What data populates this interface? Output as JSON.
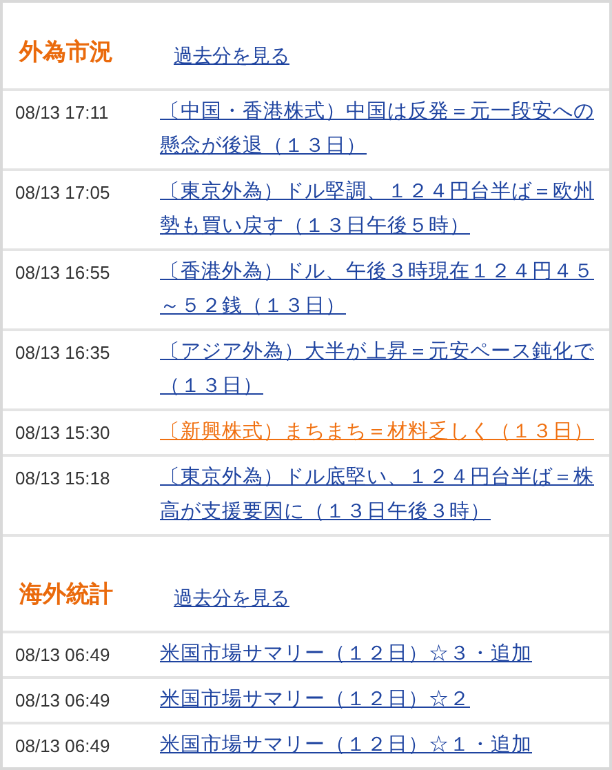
{
  "sections": [
    {
      "title": "外為市況",
      "more_link": "過去分を見る",
      "items": [
        {
          "time": "08/13 17:11",
          "headline": "〔中国・香港株式）中国は反発＝元一段安への懸念が後退（１３日）",
          "highlighted": false
        },
        {
          "time": "08/13 17:05",
          "headline": "〔東京外為）ドル堅調、１２４円台半ば＝欧州勢も買い戻す（１３日午後５時）",
          "highlighted": false
        },
        {
          "time": "08/13 16:55",
          "headline": "〔香港外為）ドル、午後３時現在１２４円４５～５２銭（１３日）",
          "highlighted": false
        },
        {
          "time": "08/13 16:35",
          "headline": "〔アジア外為）大半が上昇＝元安ペース鈍化で（１３日）",
          "highlighted": false
        },
        {
          "time": "08/13 15:30",
          "headline": "〔新興株式）まちまち＝材料乏しく（１３日）",
          "highlighted": true
        },
        {
          "time": "08/13 15:18",
          "headline": "〔東京外為）ドル底堅い、１２４円台半ば＝株高が支援要因に（１３日午後３時）",
          "highlighted": false
        }
      ]
    },
    {
      "title": "海外統計",
      "more_link": "過去分を見る",
      "items": [
        {
          "time": "08/13 06:49",
          "headline": "米国市場サマリー（１２日）☆３・追加",
          "highlighted": false
        },
        {
          "time": "08/13 06:49",
          "headline": "米国市場サマリー（１２日）☆２",
          "highlighted": false
        },
        {
          "time": "08/13 06:49",
          "headline": "米国市場サマリー（１２日）☆１・追加",
          "highlighted": false
        }
      ]
    }
  ]
}
